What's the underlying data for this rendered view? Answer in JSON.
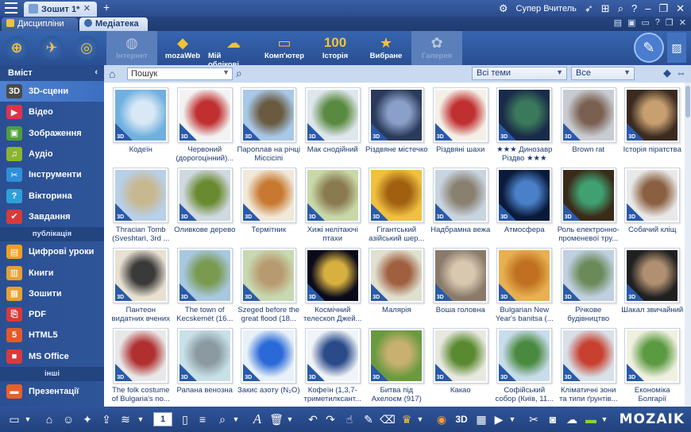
{
  "titlebar": {
    "doc_tab": "Зошит 1*",
    "doc_close": "✕",
    "new_tab": "+",
    "user": "Супер Вчитель"
  },
  "subbar": {
    "tab1": "Дисципліни",
    "tab2": "Медіатека"
  },
  "toolbar": {
    "items": [
      {
        "label": "Інтернет",
        "icon": "globe-icon",
        "enabled": false
      },
      {
        "label": "mozaWeb",
        "icon": "mozaweb-icon",
        "enabled": true
      },
      {
        "label": "Мій облікові...",
        "icon": "cloud-user-icon",
        "enabled": true
      },
      {
        "label": "Комп'ютер",
        "icon": "computer-icon",
        "enabled": true
      },
      {
        "label": "Історія",
        "icon": "history-icon",
        "enabled": true
      },
      {
        "label": "Вибране",
        "icon": "star-icon",
        "enabled": true
      },
      {
        "label": "Галерея",
        "icon": "gallery-icon",
        "enabled": false
      }
    ],
    "history_glyph": "100"
  },
  "sidebar": {
    "header": "Вміст",
    "items1": [
      {
        "label": "3D-сцени",
        "icon": "3d-icon",
        "color": "#4a4a4a"
      },
      {
        "label": "Відео",
        "icon": "video-icon",
        "color": "#e0334a"
      },
      {
        "label": "Зображення",
        "icon": "image-icon",
        "color": "#4f9f3a"
      },
      {
        "label": "Аудіо",
        "icon": "audio-icon",
        "color": "#8ab52e"
      },
      {
        "label": "Інструменти",
        "icon": "tools-icon",
        "color": "#2f8fd8"
      },
      {
        "label": "Вікторина",
        "icon": "quiz-icon",
        "color": "#2f9fd8"
      },
      {
        "label": "Завдання",
        "icon": "task-icon",
        "color": "#d83a3a"
      }
    ],
    "section1": "публікація",
    "items2": [
      {
        "label": "Цифрові уроки",
        "icon": "digital-lesson-icon",
        "color": "#f0a020"
      },
      {
        "label": "Книги",
        "icon": "book-icon",
        "color": "#e8a030"
      },
      {
        "label": "Зошити",
        "icon": "notebook-icon",
        "color": "#e8a030"
      },
      {
        "label": "PDF",
        "icon": "pdf-icon",
        "color": "#d83a3a"
      },
      {
        "label": "HTML5",
        "icon": "html5-icon",
        "color": "#e35a2a"
      },
      {
        "label": "MS Office",
        "icon": "ms-office-icon",
        "color": "#d83a3a"
      }
    ],
    "section2": "інші",
    "items3": [
      {
        "label": "Презентації",
        "icon": "presentation-icon",
        "color": "#e8602a"
      }
    ],
    "collapse": "‹"
  },
  "search": {
    "placeholder": "Пошук",
    "topics": "Всі теми",
    "filter": "Все"
  },
  "tiles": [
    {
      "label": "Кодеїн",
      "colors": [
        "#6fb0e0",
        "#d8e8f4"
      ]
    },
    {
      "label": "Червоний (дорогоцінний)...",
      "colors": [
        "#f2f2f2",
        "#c03030"
      ]
    },
    {
      "label": "Пароплав на річці Міссісіпі",
      "colors": [
        "#a8c8e8",
        "#6a5a40"
      ]
    },
    {
      "label": "Мак снодійний",
      "colors": [
        "#dfe6ee",
        "#5a8a40"
      ]
    },
    {
      "label": "Різдвяне містечко",
      "colors": [
        "#2a3a5a",
        "#8aa0c8"
      ]
    },
    {
      "label": "Різдвяні шахи",
      "colors": [
        "#f4f0e8",
        "#c03030"
      ]
    },
    {
      "label": "★★★ Динозавр Різдво ★★★",
      "colors": [
        "#1a2a4a",
        "#3a7a5a"
      ]
    },
    {
      "label": "Brown rat",
      "colors": [
        "#c8ccd2",
        "#7a6050"
      ]
    },
    {
      "label": "Історія піратства",
      "colors": [
        "#3a2a20",
        "#c8a070"
      ]
    },
    {
      "label": "Thracian Tomb (Sveshtari, 3rd ...",
      "colors": [
        "#b8d0e8",
        "#c8b890"
      ]
    },
    {
      "label": "Оливкове дерево",
      "colors": [
        "#d0d8e0",
        "#6a8a30"
      ]
    },
    {
      "label": "Термітник",
      "colors": [
        "#f0e8d8",
        "#c87830"
      ]
    },
    {
      "label": "Хижі нелітаючі птахи",
      "colors": [
        "#c8d8a8",
        "#8a7a50"
      ]
    },
    {
      "label": "Гігантський азійський шер...",
      "colors": [
        "#f0c040",
        "#a06010"
      ]
    },
    {
      "label": "Надбрамна вежа",
      "colors": [
        "#c8d4e0",
        "#8a8070"
      ]
    },
    {
      "label": "Атмосфера",
      "colors": [
        "#0a1a3a",
        "#4a80c8"
      ]
    },
    {
      "label": "Роль електронно-променевої тру...",
      "colors": [
        "#3a2a18",
        "#40a070"
      ]
    },
    {
      "label": "Собачий кліщ",
      "colors": [
        "#e8e8e8",
        "#8a6040"
      ]
    },
    {
      "label": "Пантеон видатних вчених",
      "colors": [
        "#e8e0d0",
        "#3a3a3a"
      ]
    },
    {
      "label": "The town of Kecskemét (16...",
      "colors": [
        "#a8c8e0",
        "#7a9a50"
      ]
    },
    {
      "label": "Szeged before the great flood (18...",
      "colors": [
        "#c8d8b0",
        "#b89a70"
      ]
    },
    {
      "label": "Космічний телескоп Джей...",
      "colors": [
        "#0a0a1a",
        "#d8b040"
      ]
    },
    {
      "label": "Малярія",
      "colors": [
        "#e0e0d0",
        "#a06040"
      ]
    },
    {
      "label": "Воша головна",
      "colors": [
        "#8a7a6a",
        "#d8c8b0"
      ]
    },
    {
      "label": "Bulgarian New Year's banitsa (...",
      "colors": [
        "#e8b050",
        "#c07020"
      ]
    },
    {
      "label": "Річкове будівництво",
      "colors": [
        "#c0d0e0",
        "#6a8a5a"
      ]
    },
    {
      "label": "Шакал звичайний",
      "colors": [
        "#202020",
        "#b09070"
      ]
    },
    {
      "label": "The folk costume of Bulgaria's no...",
      "colors": [
        "#e8e8e8",
        "#b03030"
      ]
    },
    {
      "label": "Рапана венозна",
      "colors": [
        "#c8e0e8",
        "#8a9aa0"
      ]
    },
    {
      "label": "Закис азоту (N₂O)",
      "colors": [
        "#e8f0f8",
        "#2a6ad8"
      ]
    },
    {
      "label": "Кофеїн (1,3,7-триметилксант...",
      "colors": [
        "#f0f4f8",
        "#2a4a8a"
      ]
    },
    {
      "label": "Битва під Ахелоєм (917)",
      "colors": [
        "#6a9a40",
        "#c8b070"
      ]
    },
    {
      "label": "Какао",
      "colors": [
        "#e8e8e0",
        "#5a8a30"
      ]
    },
    {
      "label": "Софійський собор (Київ, 11...",
      "colors": [
        "#c8dcec",
        "#4a8a40"
      ]
    },
    {
      "label": "Кліматичні зони та типи ґрунтів...",
      "colors": [
        "#d8e0e8",
        "#c84030"
      ]
    },
    {
      "label": "Економіка Болгарії",
      "colors": [
        "#f0f0e0",
        "#5a9a40"
      ]
    }
  ],
  "bottombar": {
    "page": "1",
    "logo": "MOZAIK"
  }
}
